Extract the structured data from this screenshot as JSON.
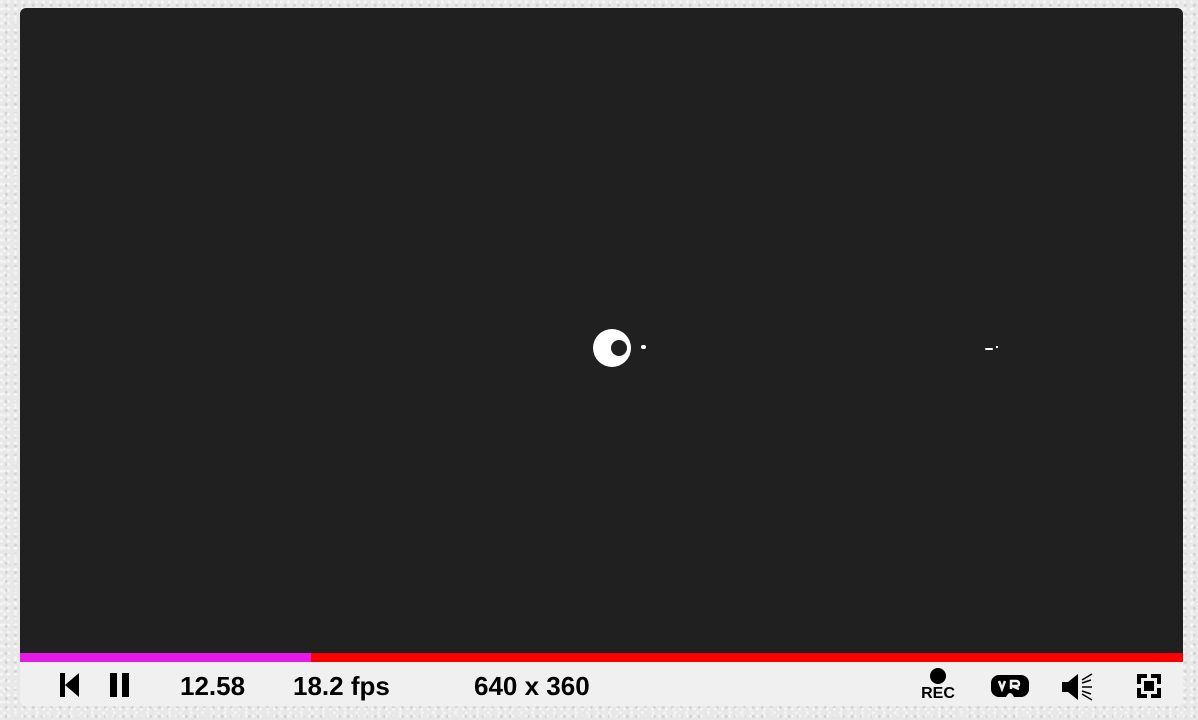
{
  "playback": {
    "time": "12.58",
    "fps": "18.2 fps",
    "resolution": "640 x 360",
    "progress_fraction": 0.25
  },
  "buttons": {
    "rec_label": "REC"
  },
  "icons": {
    "rewind": "skip-to-start-icon",
    "pause": "pause-icon",
    "record": "record-icon",
    "vr": "vr-headset-icon",
    "volume": "volume-icon",
    "fullscreen": "fullscreen-icon"
  },
  "colors": {
    "canvas_background": "#202020",
    "progress_played": "#e619e6",
    "progress_remaining": "#ff0000",
    "controls_background": "#f0f0f0",
    "shape_color": "#ffffff"
  }
}
